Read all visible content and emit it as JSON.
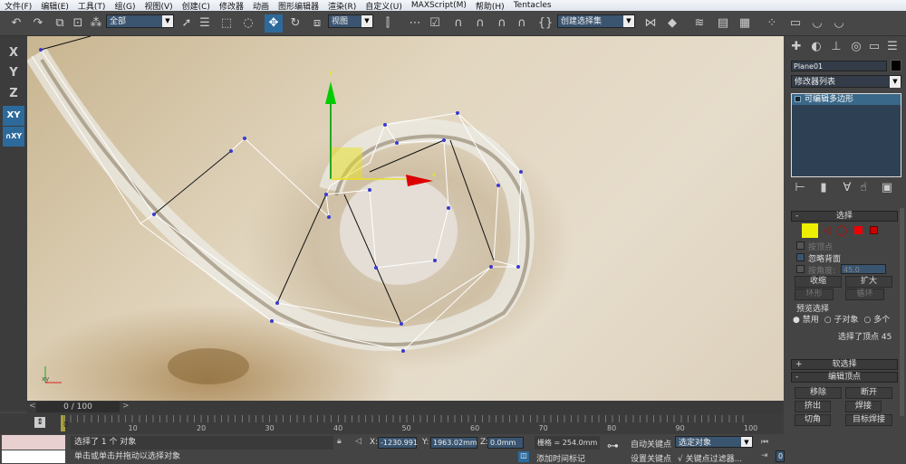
{
  "menu": [
    "文件(F)",
    "编辑(E)",
    "工具(T)",
    "组(G)",
    "视图(V)",
    "创建(C)",
    "修改器",
    "动画",
    "图形编辑器",
    "渲染(R)",
    "自定义(U)",
    "MAXScript(M)",
    "帮助(H)",
    "Tentacles"
  ],
  "toolbar": {
    "selection_filter": "全部",
    "ref_coord": "视图",
    "named_selection": "创建选择集"
  },
  "axis_constraints": [
    "X",
    "Y",
    "Z",
    "XY",
    "XY"
  ],
  "viewport": {
    "gizmo_x": "x",
    "gizmo_y": "y",
    "corner_axis": "xy"
  },
  "command_panel": {
    "object_name": "Plane01",
    "object_color": "#000000",
    "modifier_list": "修改器列表",
    "stack": [
      "可编辑多边形"
    ],
    "selection": {
      "title": "选择",
      "by_vertex": "按顶点",
      "ignore_backfacing": "忽略背面",
      "by_angle": "按角度:",
      "angle_value": "45.0",
      "shrink": "收缩",
      "grow": "扩大",
      "ring": "环形",
      "loop": "循环",
      "preview_title": "预览选择",
      "preview_options": [
        "禁用",
        "子对象",
        "多个"
      ],
      "status": "选择了顶点 45"
    },
    "soft_selection": "软选择",
    "edit_vertices": {
      "title": "编辑顶点",
      "remove": "移除",
      "break": "断开",
      "extrude": "挤出",
      "weld": "焊接",
      "chamfer": "切角",
      "target_weld": "目标焊接"
    }
  },
  "time_slider": {
    "label": "0 / 100",
    "current": 0,
    "max": 100
  },
  "trackbar": {
    "ticks": [
      "0",
      "10",
      "20",
      "30",
      "40",
      "50",
      "60",
      "70",
      "80",
      "90",
      "100"
    ]
  },
  "status": {
    "selected": "选择了 1 个 对象",
    "prompt": "单击或单击并拖动以选择对象",
    "x": "-1230.991",
    "y": "1963.02mm",
    "z": "0.0mm",
    "grid": "栅格 = 254.0mm",
    "add_time_tag": "添加时间标记",
    "auto_key": "自动关键点",
    "set_key": "设置关键点",
    "key_mode": "选定对象",
    "key_filters": "关键点过滤器...",
    "frame": "0"
  }
}
